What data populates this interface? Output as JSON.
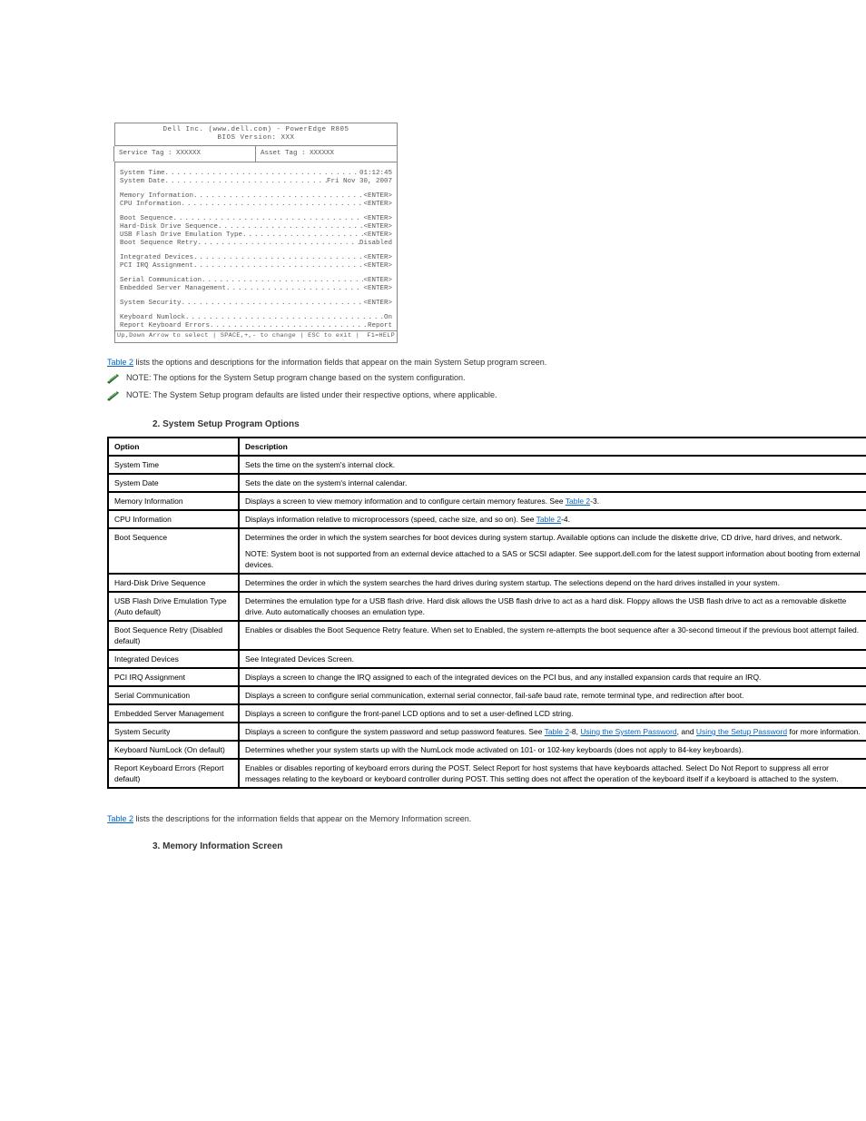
{
  "bios": {
    "title_line1": "Dell Inc. (www.dell.com) - PowerEdge R805",
    "title_line2": "BIOS Version: XXX",
    "service_tag_label": "Service Tag : XXXXXX",
    "asset_tag_label": "Asset Tag : XXXXXX",
    "groups": [
      [
        {
          "label": "System Time ",
          "value": " 01:12:45"
        },
        {
          "label": "System Date ",
          "value": " Fri Nov 30, 2007"
        }
      ],
      [
        {
          "label": "Memory Information ",
          "value": " <ENTER>"
        },
        {
          "label": "CPU Information ",
          "value": " <ENTER>"
        }
      ],
      [
        {
          "label": "Boot Sequence ",
          "value": " <ENTER>"
        },
        {
          "label": "Hard-Disk Drive Sequence",
          "value": " <ENTER>"
        },
        {
          "label": "USB Flash Drive Emulation Type",
          "value": " <ENTER>"
        },
        {
          "label": "Boot Sequence Retry ",
          "value": " Disabled"
        }
      ],
      [
        {
          "label": "Integrated Devices ",
          "value": " <ENTER>"
        },
        {
          "label": "PCI IRQ Assignment ",
          "value": " <ENTER>"
        }
      ],
      [
        {
          "label": "Serial Communication ",
          "value": " <ENTER>"
        },
        {
          "label": "Embedded Server Management ",
          "value": " <ENTER>"
        }
      ],
      [
        {
          "label": "System Security ",
          "value": " <ENTER>"
        }
      ],
      [
        {
          "label": "Keyboard Numlock ",
          "value": "On"
        },
        {
          "label": "Report Keyboard Errors ",
          "value": "Report"
        }
      ]
    ],
    "footer_left": "Up,Down Arrow to select | SPACE,+,- to change | ESC to exit |",
    "footer_right": "F1=HELP"
  },
  "link_table2": "Table 2",
  "para_after_fig": " lists the options and descriptions for the information fields that appear on the main System Setup program screen.",
  "note1": "NOTE: The options for the System Setup program change based on the system configuration.",
  "note2": "NOTE: The System Setup program defaults are listed under their respective options, where applicable.",
  "table2": {
    "caption": "2. System Setup Program Options",
    "columns": [
      "Option",
      "Description"
    ],
    "rows": [
      {
        "option": "System Time",
        "desc": "Sets the time on the system's internal clock."
      },
      {
        "option": "System Date",
        "desc": "Sets the date on the system's internal calendar."
      },
      {
        "option": "Memory Information",
        "desc": {
          "pre": "Displays a screen to view memory information and to configure certain memory features. See ",
          "link": "Table 2",
          "post": "-3."
        }
      },
      {
        "option": "CPU Information",
        "desc": {
          "pre": "Displays information relative to microprocessors (speed, cache size, and so on). See ",
          "link": "Table 2",
          "post": "-4."
        }
      },
      {
        "option": "Boot Sequence",
        "desc_lines": [
          "Determines the order in which the system searches for boot devices during system startup. Available options can include the diskette drive, CD drive, hard drives, and network.",
          "",
          "NOTE: System boot is not supported from an external device attached to a SAS or SCSI adapter. See support.dell.com for the latest support information about booting from external devices."
        ]
      },
      {
        "option": "Hard-Disk Drive Sequence",
        "desc": "Determines the order in which the system searches the hard drives during system startup. The selections depend on the hard drives installed in your system."
      },
      {
        "option": "USB Flash Drive Emulation Type (Auto default)",
        "desc": "Determines the emulation type for a USB flash drive. Hard disk allows the USB flash drive to act as a hard disk. Floppy allows the USB flash drive to act as a removable diskette drive. Auto automatically chooses an emulation type."
      },
      {
        "option": "Boot Sequence Retry (Disabled default)",
        "desc": "Enables or disables the Boot Sequence Retry feature. When set to Enabled, the system re-attempts the boot sequence after a 30-second timeout if the previous boot attempt failed."
      },
      {
        "option": "Integrated Devices",
        "desc": "See Integrated Devices Screen."
      },
      {
        "option": "PCI IRQ Assignment",
        "desc": "Displays a screen to change the IRQ assigned to each of the integrated devices on the PCI bus, and any installed expansion cards that require an IRQ."
      },
      {
        "option": "Serial Communication",
        "desc": "Displays a screen to configure serial communication, external serial connector, fail-safe baud rate, remote terminal type, and redirection after boot."
      },
      {
        "option": "Embedded Server Management",
        "desc": "Displays a screen to configure the front-panel LCD options and to set a user-defined LCD string."
      },
      {
        "option": "System Security",
        "desc": {
          "pre": "Displays a screen to configure the system password and setup password features. See ",
          "link": "Table 2",
          "post": "-8, ",
          "link2_pre": "Using the System Password",
          "link2_post": ", and ",
          "link3_pre": "Using the Setup Password",
          "link3_post": " for more information."
        }
      },
      {
        "option": "Keyboard NumLock (On default)",
        "desc": "Determines whether your system starts up with the NumLock mode activated on 101- or 102-key keyboards (does not apply to 84-key keyboards)."
      },
      {
        "option": "Report Keyboard Errors (Report default)",
        "desc": "Enables or disables reporting of keyboard errors during the POST. Select Report for host systems that have keyboards attached. Select Do Not Report to suppress all error messages relating to the keyboard or keyboard controller during POST. This setting does not affect the operation of the keyboard itself if a keyboard is attached to the system."
      }
    ]
  },
  "memory_section": {
    "heading_text": "Memory Information Screen",
    "para": " lists the descriptions for the information fields that appear on the Memory Information screen.",
    "caption": "3. Memory Information Screen"
  }
}
